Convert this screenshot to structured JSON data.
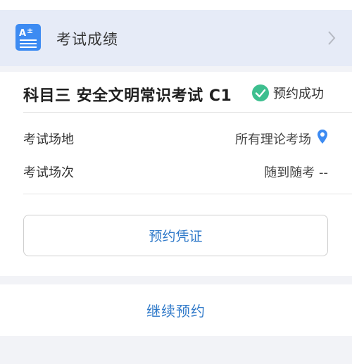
{
  "score": {
    "label": "考试成绩",
    "icon": "grade-doc-icon",
    "icon_color": "#3d8bf2"
  },
  "booking": {
    "subject": "科目三 安全文明常识考试 C1",
    "status": "预约成功",
    "status_color": "#3dbf8f",
    "venue_label": "考试场地",
    "venue_value": "所有理论考场",
    "session_label": "考试场次",
    "session_value": "随到随考 --",
    "voucher_button": "预约凭证"
  },
  "footer": {
    "continue_label": "继续预约"
  },
  "colors": {
    "accent": "#2f79c9",
    "pin": "#3d8bf2",
    "background": "#f2f3f7"
  }
}
